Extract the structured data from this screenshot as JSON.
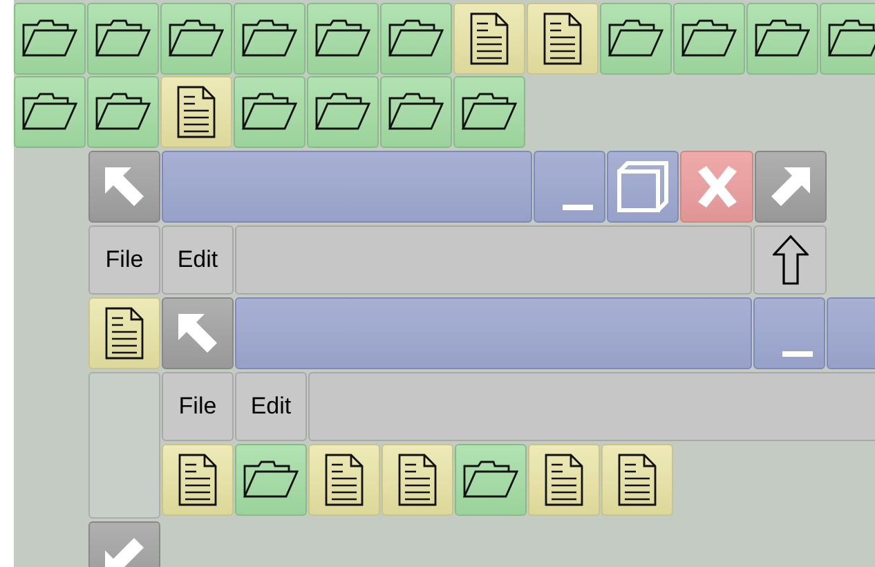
{
  "desktop_rows": [
    [
      {
        "kind": "folder"
      },
      {
        "kind": "folder"
      },
      {
        "kind": "folder"
      },
      {
        "kind": "folder"
      },
      {
        "kind": "folder"
      },
      {
        "kind": "folder"
      },
      {
        "kind": "file"
      },
      {
        "kind": "file"
      },
      {
        "kind": "folder"
      },
      {
        "kind": "folder"
      },
      {
        "kind": "folder"
      },
      {
        "kind": "folder"
      }
    ],
    [
      {
        "kind": "folder"
      },
      {
        "kind": "folder"
      },
      {
        "kind": "file"
      },
      {
        "kind": "folder"
      },
      {
        "kind": "folder"
      },
      {
        "kind": "folder"
      },
      {
        "kind": "folder"
      }
    ]
  ],
  "window": {
    "menu": [
      "File",
      "Edit"
    ],
    "side_tiles": [
      {
        "kind": "file"
      }
    ],
    "inner_window": {
      "menu": [
        "File",
        "Edit"
      ],
      "tiles": [
        {
          "kind": "file"
        },
        {
          "kind": "folder"
        },
        {
          "kind": "file"
        },
        {
          "kind": "file"
        },
        {
          "kind": "folder"
        },
        {
          "kind": "file"
        },
        {
          "kind": "file"
        }
      ]
    }
  }
}
